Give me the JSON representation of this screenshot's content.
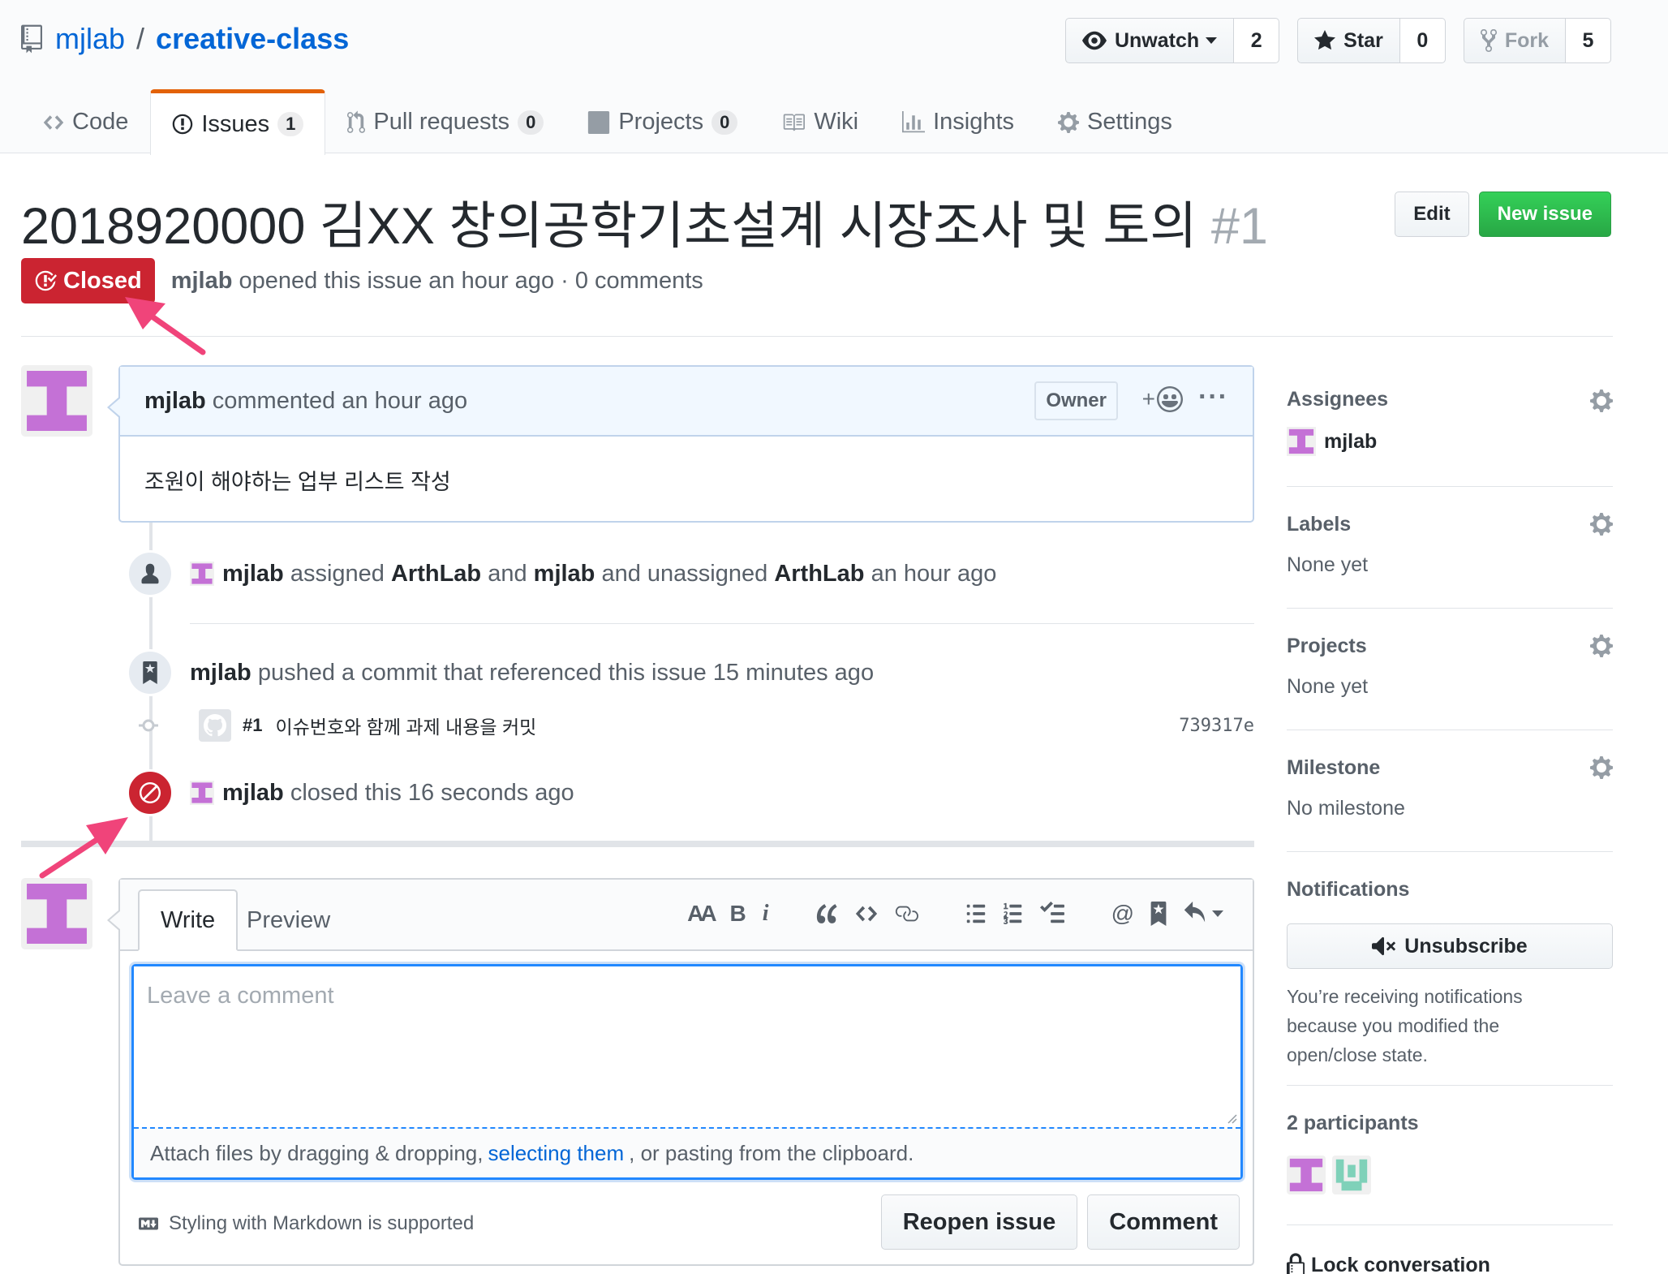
{
  "repo": {
    "owner": "mjlab",
    "separator": "/",
    "name": "creative-class"
  },
  "actions": {
    "watch": {
      "label": "Unwatch",
      "count": "2"
    },
    "star": {
      "label": "Star",
      "count": "0"
    },
    "fork": {
      "label": "Fork",
      "count": "5"
    }
  },
  "nav": {
    "code": "Code",
    "issues": {
      "label": "Issues",
      "count": "1"
    },
    "pulls": {
      "label": "Pull requests",
      "count": "0"
    },
    "projects": {
      "label": "Projects",
      "count": "0"
    },
    "wiki": "Wiki",
    "insights": "Insights",
    "settings": "Settings"
  },
  "issue": {
    "title": "2018920000 김XX 창의공학기초설계 시장조사 및 토의",
    "number": "#1",
    "edit_label": "Edit",
    "new_issue_label": "New issue",
    "state": "Closed",
    "author": "mjlab",
    "meta_text": "opened this issue an hour ago · 0 comments"
  },
  "comment": {
    "author": "mjlab",
    "time_text": "commented an hour ago",
    "owner_label": "Owner",
    "body": "조원이 해야하는 업부 리스트 작성"
  },
  "events": {
    "assign": {
      "actor": "mjlab",
      "t1": "assigned",
      "u1": "ArthLab",
      "t2": "and",
      "u2": "mjlab",
      "t3": "and unassigned",
      "u3": "ArthLab",
      "t4": "an hour ago"
    },
    "push": {
      "actor": "mjlab",
      "text": "pushed a commit that referenced this issue 15 minutes ago"
    },
    "commit": {
      "ref": "#1",
      "message": "이슈번호와 함께 과제 내용을 커밋",
      "sha": "739317e"
    },
    "closed": {
      "actor": "mjlab",
      "text": "closed this 16 seconds ago"
    }
  },
  "form": {
    "tab_write": "Write",
    "tab_preview": "Preview",
    "placeholder": "Leave a comment",
    "attach_pre": "Attach files by dragging & dropping,",
    "attach_link": "selecting them",
    "attach_post": ", or pasting from the clipboard.",
    "markdown_hint": "Styling with Markdown is supported",
    "reopen_label": "Reopen issue",
    "comment_label": "Comment",
    "toolbar": {
      "header": "AA",
      "bold": "B",
      "italic": "i",
      "mention": "@"
    }
  },
  "sidebar": {
    "assignees": {
      "title": "Assignees",
      "user": "mjlab"
    },
    "labels": {
      "title": "Labels",
      "value": "None yet"
    },
    "projects": {
      "title": "Projects",
      "value": "None yet"
    },
    "milestone": {
      "title": "Milestone",
      "value": "No milestone"
    },
    "notifications": {
      "title": "Notifications",
      "button": "Unsubscribe",
      "reason": "You’re receiving notifications because you modified the open/close state."
    },
    "participants": {
      "title": "2 participants"
    },
    "lock": "Lock conversation"
  },
  "colors": {
    "link": "#0366d6",
    "closed_red": "#cb2431",
    "green": "#28a745",
    "annotation_arrow": "#f0447a",
    "avatar_purple": "#c471d6",
    "avatar_teal": "#7fd1b9"
  },
  "icons": [
    "repo-icon",
    "eye-icon",
    "star-icon",
    "fork-icon",
    "code-icon",
    "issue-icon",
    "pull-request-icon",
    "project-icon",
    "wiki-icon",
    "graph-icon",
    "gear-icon",
    "issue-closed-icon",
    "smiley-icon",
    "person-icon",
    "bookmark-icon",
    "circle-slash-icon",
    "commit-node-icon",
    "markdown-icon",
    "mute-icon",
    "lock-icon"
  ]
}
